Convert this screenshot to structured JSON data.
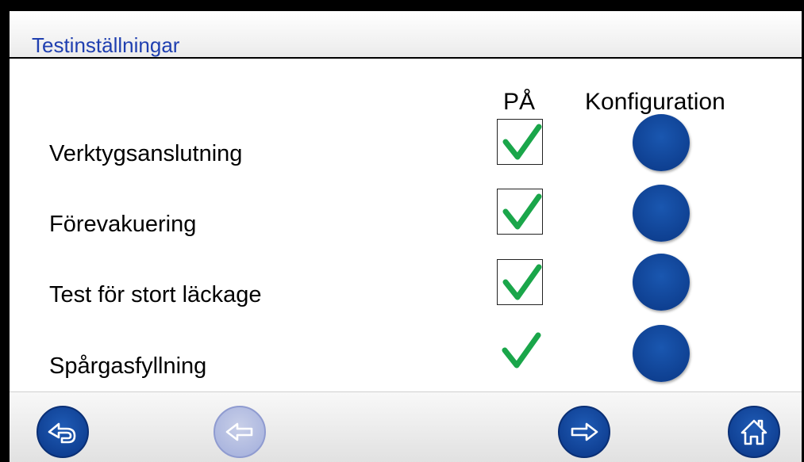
{
  "header": {
    "title": "Testinställningar"
  },
  "columns": {
    "on_label": "PÅ",
    "config_label": "Konfiguration"
  },
  "rows": [
    {
      "label": "Verktygsanslutning",
      "enabled": true,
      "checkbox_shown": true
    },
    {
      "label": "Förevakuering",
      "enabled": true,
      "checkbox_shown": true
    },
    {
      "label": "Test för stort läckage",
      "enabled": true,
      "checkbox_shown": true
    },
    {
      "label": "Spårgasfyllning",
      "enabled": true,
      "checkbox_shown": false
    }
  ],
  "icons": {
    "checkmark": "checkmark-icon",
    "config": "config-button",
    "nav_back": "return-arrow-icon",
    "nav_prev": "arrow-left-icon",
    "nav_next": "arrow-right-icon",
    "nav_home": "home-icon"
  },
  "colors": {
    "title": "#1f3fb0",
    "check": "#1aa64a",
    "button": "#0e3f90",
    "button_disabled": "#b3bde2"
  }
}
